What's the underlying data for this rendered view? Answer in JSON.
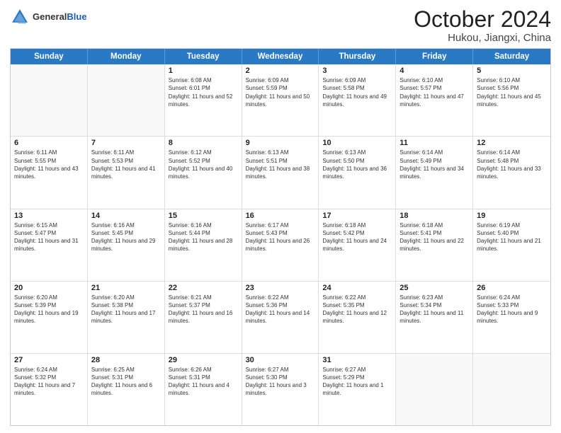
{
  "header": {
    "logo_general": "General",
    "logo_blue": "Blue",
    "title": "October 2024",
    "subtitle": "Hukou, Jiangxi, China"
  },
  "weekdays": [
    "Sunday",
    "Monday",
    "Tuesday",
    "Wednesday",
    "Thursday",
    "Friday",
    "Saturday"
  ],
  "weeks": [
    [
      {
        "day": "",
        "sunrise": "",
        "sunset": "",
        "daylight": ""
      },
      {
        "day": "",
        "sunrise": "",
        "sunset": "",
        "daylight": ""
      },
      {
        "day": "1",
        "sunrise": "Sunrise: 6:08 AM",
        "sunset": "Sunset: 6:01 PM",
        "daylight": "Daylight: 11 hours and 52 minutes."
      },
      {
        "day": "2",
        "sunrise": "Sunrise: 6:09 AM",
        "sunset": "Sunset: 5:59 PM",
        "daylight": "Daylight: 11 hours and 50 minutes."
      },
      {
        "day": "3",
        "sunrise": "Sunrise: 6:09 AM",
        "sunset": "Sunset: 5:58 PM",
        "daylight": "Daylight: 11 hours and 49 minutes."
      },
      {
        "day": "4",
        "sunrise": "Sunrise: 6:10 AM",
        "sunset": "Sunset: 5:57 PM",
        "daylight": "Daylight: 11 hours and 47 minutes."
      },
      {
        "day": "5",
        "sunrise": "Sunrise: 6:10 AM",
        "sunset": "Sunset: 5:56 PM",
        "daylight": "Daylight: 11 hours and 45 minutes."
      }
    ],
    [
      {
        "day": "6",
        "sunrise": "Sunrise: 6:11 AM",
        "sunset": "Sunset: 5:55 PM",
        "daylight": "Daylight: 11 hours and 43 minutes."
      },
      {
        "day": "7",
        "sunrise": "Sunrise: 6:11 AM",
        "sunset": "Sunset: 5:53 PM",
        "daylight": "Daylight: 11 hours and 41 minutes."
      },
      {
        "day": "8",
        "sunrise": "Sunrise: 6:12 AM",
        "sunset": "Sunset: 5:52 PM",
        "daylight": "Daylight: 11 hours and 40 minutes."
      },
      {
        "day": "9",
        "sunrise": "Sunrise: 6:13 AM",
        "sunset": "Sunset: 5:51 PM",
        "daylight": "Daylight: 11 hours and 38 minutes."
      },
      {
        "day": "10",
        "sunrise": "Sunrise: 6:13 AM",
        "sunset": "Sunset: 5:50 PM",
        "daylight": "Daylight: 11 hours and 36 minutes."
      },
      {
        "day": "11",
        "sunrise": "Sunrise: 6:14 AM",
        "sunset": "Sunset: 5:49 PM",
        "daylight": "Daylight: 11 hours and 34 minutes."
      },
      {
        "day": "12",
        "sunrise": "Sunrise: 6:14 AM",
        "sunset": "Sunset: 5:48 PM",
        "daylight": "Daylight: 11 hours and 33 minutes."
      }
    ],
    [
      {
        "day": "13",
        "sunrise": "Sunrise: 6:15 AM",
        "sunset": "Sunset: 5:47 PM",
        "daylight": "Daylight: 11 hours and 31 minutes."
      },
      {
        "day": "14",
        "sunrise": "Sunrise: 6:16 AM",
        "sunset": "Sunset: 5:45 PM",
        "daylight": "Daylight: 11 hours and 29 minutes."
      },
      {
        "day": "15",
        "sunrise": "Sunrise: 6:16 AM",
        "sunset": "Sunset: 5:44 PM",
        "daylight": "Daylight: 11 hours and 28 minutes."
      },
      {
        "day": "16",
        "sunrise": "Sunrise: 6:17 AM",
        "sunset": "Sunset: 5:43 PM",
        "daylight": "Daylight: 11 hours and 26 minutes."
      },
      {
        "day": "17",
        "sunrise": "Sunrise: 6:18 AM",
        "sunset": "Sunset: 5:42 PM",
        "daylight": "Daylight: 11 hours and 24 minutes."
      },
      {
        "day": "18",
        "sunrise": "Sunrise: 6:18 AM",
        "sunset": "Sunset: 5:41 PM",
        "daylight": "Daylight: 11 hours and 22 minutes."
      },
      {
        "day": "19",
        "sunrise": "Sunrise: 6:19 AM",
        "sunset": "Sunset: 5:40 PM",
        "daylight": "Daylight: 11 hours and 21 minutes."
      }
    ],
    [
      {
        "day": "20",
        "sunrise": "Sunrise: 6:20 AM",
        "sunset": "Sunset: 5:39 PM",
        "daylight": "Daylight: 11 hours and 19 minutes."
      },
      {
        "day": "21",
        "sunrise": "Sunrise: 6:20 AM",
        "sunset": "Sunset: 5:38 PM",
        "daylight": "Daylight: 11 hours and 17 minutes."
      },
      {
        "day": "22",
        "sunrise": "Sunrise: 6:21 AM",
        "sunset": "Sunset: 5:37 PM",
        "daylight": "Daylight: 11 hours and 16 minutes."
      },
      {
        "day": "23",
        "sunrise": "Sunrise: 6:22 AM",
        "sunset": "Sunset: 5:36 PM",
        "daylight": "Daylight: 11 hours and 14 minutes."
      },
      {
        "day": "24",
        "sunrise": "Sunrise: 6:22 AM",
        "sunset": "Sunset: 5:35 PM",
        "daylight": "Daylight: 11 hours and 12 minutes."
      },
      {
        "day": "25",
        "sunrise": "Sunrise: 6:23 AM",
        "sunset": "Sunset: 5:34 PM",
        "daylight": "Daylight: 11 hours and 11 minutes."
      },
      {
        "day": "26",
        "sunrise": "Sunrise: 6:24 AM",
        "sunset": "Sunset: 5:33 PM",
        "daylight": "Daylight: 11 hours and 9 minutes."
      }
    ],
    [
      {
        "day": "27",
        "sunrise": "Sunrise: 6:24 AM",
        "sunset": "Sunset: 5:32 PM",
        "daylight": "Daylight: 11 hours and 7 minutes."
      },
      {
        "day": "28",
        "sunrise": "Sunrise: 6:25 AM",
        "sunset": "Sunset: 5:31 PM",
        "daylight": "Daylight: 11 hours and 6 minutes."
      },
      {
        "day": "29",
        "sunrise": "Sunrise: 6:26 AM",
        "sunset": "Sunset: 5:31 PM",
        "daylight": "Daylight: 11 hours and 4 minutes."
      },
      {
        "day": "30",
        "sunrise": "Sunrise: 6:27 AM",
        "sunset": "Sunset: 5:30 PM",
        "daylight": "Daylight: 11 hours and 3 minutes."
      },
      {
        "day": "31",
        "sunrise": "Sunrise: 6:27 AM",
        "sunset": "Sunset: 5:29 PM",
        "daylight": "Daylight: 11 hours and 1 minute."
      },
      {
        "day": "",
        "sunrise": "",
        "sunset": "",
        "daylight": ""
      },
      {
        "day": "",
        "sunrise": "",
        "sunset": "",
        "daylight": ""
      }
    ]
  ]
}
